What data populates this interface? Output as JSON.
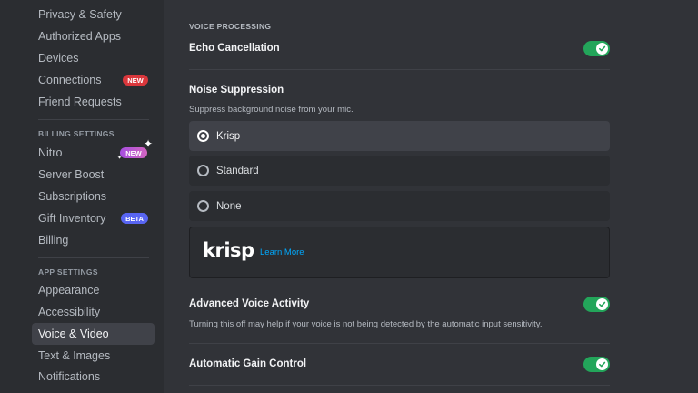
{
  "sidebar": {
    "user_items": [
      {
        "label": "Privacy & Safety"
      },
      {
        "label": "Authorized Apps"
      },
      {
        "label": "Devices"
      },
      {
        "label": "Connections",
        "badge": "NEW"
      },
      {
        "label": "Friend Requests"
      }
    ],
    "billing_header": "BILLING SETTINGS",
    "billing_items": [
      {
        "label": "Nitro",
        "badge": "NEW"
      },
      {
        "label": "Server Boost"
      },
      {
        "label": "Subscriptions"
      },
      {
        "label": "Gift Inventory",
        "badge": "BETA"
      },
      {
        "label": "Billing"
      }
    ],
    "app_header": "APP SETTINGS",
    "app_items": [
      {
        "label": "Appearance"
      },
      {
        "label": "Accessibility"
      },
      {
        "label": "Voice & Video",
        "active": true
      },
      {
        "label": "Text & Images"
      },
      {
        "label": "Notifications"
      }
    ]
  },
  "main": {
    "section_header": "VOICE PROCESSING",
    "echo_cancellation": {
      "label": "Echo Cancellation",
      "enabled": true
    },
    "noise_suppression": {
      "label": "Noise Suppression",
      "description": "Suppress background noise from your mic.",
      "options": [
        {
          "label": "Krisp",
          "selected": true
        },
        {
          "label": "Standard",
          "selected": false
        },
        {
          "label": "None",
          "selected": false
        }
      ],
      "krisp_logo": "krisp",
      "learn_more": "Learn More"
    },
    "advanced_voice_activity": {
      "label": "Advanced Voice Activity",
      "description": "Turning this off may help if your voice is not being detected by the automatic input sensitivity.",
      "enabled": true
    },
    "automatic_gain_control": {
      "label": "Automatic Gain Control",
      "enabled": true
    }
  },
  "colors": {
    "toggle_on": "#23a55a",
    "badge_new": "#da373c",
    "badge_beta": "#5865f2",
    "link": "#00a8fc"
  },
  "icons": {
    "toggle_check": "check-icon",
    "nitro_sparkle": "sparkle-icon"
  }
}
